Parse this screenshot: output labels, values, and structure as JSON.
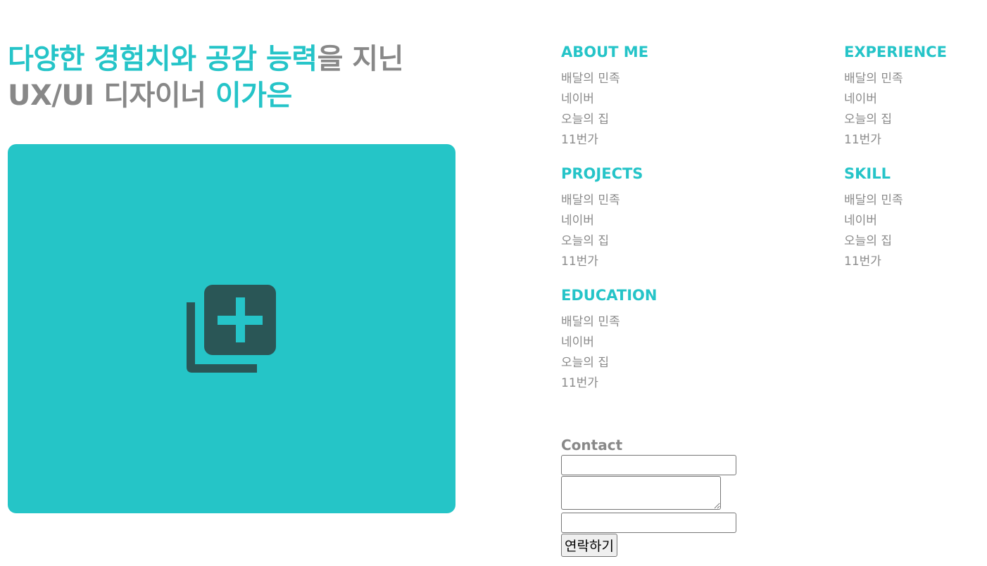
{
  "hero": {
    "line1_accent1": "다양한 경험치와 공감 능력",
    "line1_muted": "을 지닌",
    "line2_muted": "UX/UI 디자이너 ",
    "line2_accent": "이가은",
    "card_color": "#25c5c7",
    "icon": "add-to-library-icon"
  },
  "colors": {
    "accent": "#25c4c8",
    "muted_text": "#888888",
    "icon_dark": "#2a5656"
  },
  "sections": {
    "about": {
      "heading": "ABOUT ME",
      "items": [
        "배달의 민족",
        "네이버",
        "오늘의 집",
        "11번가"
      ]
    },
    "experience": {
      "heading": "EXPERIENCE",
      "items": [
        "배달의 민족",
        "네이버",
        "오늘의 집",
        "11번가"
      ]
    },
    "projects": {
      "heading": "PROJECTS",
      "items": [
        "배달의 민족",
        "네이버",
        "오늘의 집",
        "11번가"
      ]
    },
    "skill": {
      "heading": "SKILL",
      "items": [
        "배달의 민족",
        "네이버",
        "오늘의 집",
        "11번가"
      ]
    },
    "education": {
      "heading": "EDUCATION",
      "items": [
        "배달의 민족",
        "네이버",
        "오늘의 집",
        "11번가"
      ]
    }
  },
  "contact": {
    "title": "Contact",
    "name_value": "",
    "message_value": "",
    "email_value": "",
    "submit_label": "연락하기"
  }
}
